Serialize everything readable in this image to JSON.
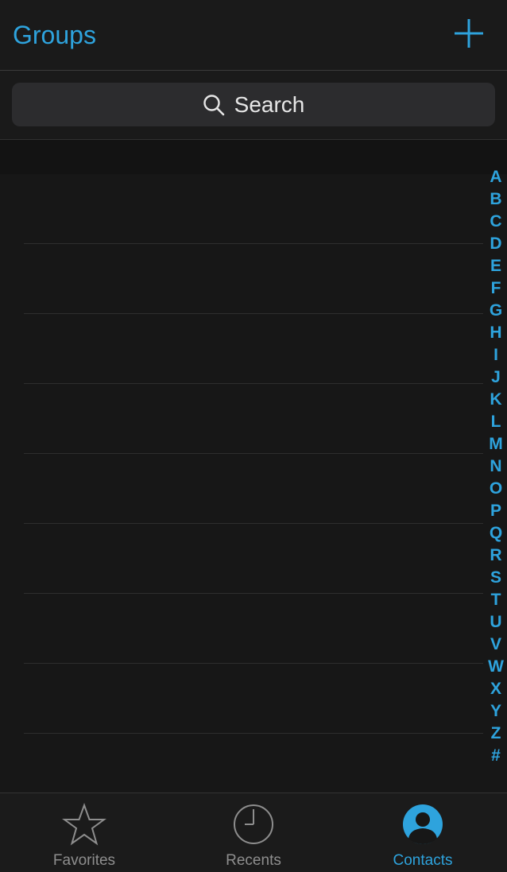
{
  "navbar": {
    "left_label": "Groups",
    "add_icon": "plus-icon"
  },
  "search": {
    "placeholder": "Search",
    "icon": "search-icon"
  },
  "index": [
    "A",
    "B",
    "C",
    "D",
    "E",
    "F",
    "G",
    "H",
    "I",
    "J",
    "K",
    "L",
    "M",
    "N",
    "O",
    "P",
    "Q",
    "R",
    "S",
    "T",
    "U",
    "V",
    "W",
    "X",
    "Y",
    "Z",
    "#"
  ],
  "tabbar": {
    "tabs": [
      {
        "label": "Favorites",
        "icon": "star-icon",
        "active": false
      },
      {
        "label": "Recents",
        "icon": "clock-icon",
        "active": false
      },
      {
        "label": "Contacts",
        "icon": "contacts-icon",
        "active": true
      }
    ]
  },
  "colors": {
    "accent": "#2ea3dd",
    "background": "#171717",
    "inactive": "#8e8e8e"
  }
}
